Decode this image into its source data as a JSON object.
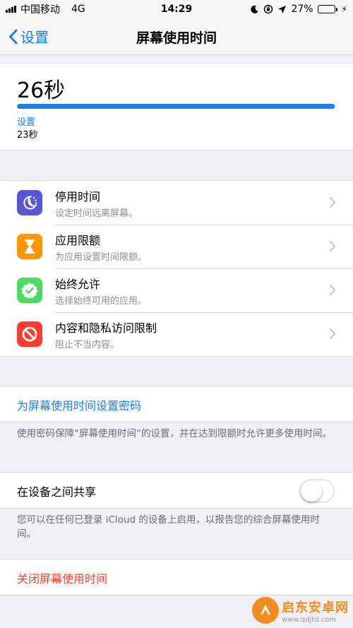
{
  "status_bar": {
    "carrier": "中国移动",
    "network": "4G",
    "time": "14:29",
    "battery_percent": "27%",
    "battery_level": 0.27,
    "battery_color": "#4cd964"
  },
  "nav": {
    "back_label": "设置",
    "title": "屏幕使用时间",
    "accent_color": "#157efb"
  },
  "usage": {
    "total": "26秒",
    "category": "设置",
    "category_time": "23秒",
    "progress": 0.995
  },
  "menu": [
    {
      "title": "停用时间",
      "subtitle": "设定时间远离屏幕。",
      "icon": "downtime-icon",
      "color": "#5856d6"
    },
    {
      "title": "应用限额",
      "subtitle": "为应用设置时间限额。",
      "icon": "hourglass-icon",
      "color": "#ff9500"
    },
    {
      "title": "始终允许",
      "subtitle": "选择始终可用的应用。",
      "icon": "checkmark-badge-icon",
      "color": "#4cd964"
    },
    {
      "title": "内容和隐私访问限制",
      "subtitle": "阻止不当内容。",
      "icon": "no-entry-icon",
      "color": "#ff3b30"
    }
  ],
  "passcode": {
    "label": "为屏幕使用时间设置密码",
    "footnote": "使用密码保障“屏幕使用时间”的设置，并在达到限额时允许更多使用时间。"
  },
  "share": {
    "label": "在设备之间共享",
    "enabled": false,
    "footnote": "您可以在任何已登录 iCloud 的设备上启用，以报告您的综合屏幕使用时间。"
  },
  "turn_off": {
    "label": "关闭屏幕使用时间",
    "color": "#ff3b30"
  },
  "watermark": {
    "name": "启东安卓网",
    "url": "www.qdjtd.com"
  }
}
